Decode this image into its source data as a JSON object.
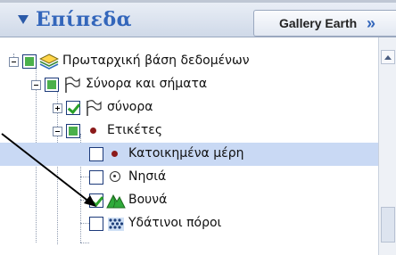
{
  "header": {
    "title": "Επίπεδα",
    "gallery_label": "Gallery Earth",
    "gallery_chevron": "»"
  },
  "tree": {
    "items": [
      {
        "label": "Πρωταρχική βάση δεδομένων",
        "icon": "layers-stack-icon",
        "state": "partial"
      },
      {
        "label": "Σύνορα και σήματα",
        "icon": "flag-icon",
        "state": "partial"
      },
      {
        "label": "σύνορα",
        "icon": "flag-icon",
        "state": "checked"
      },
      {
        "label": "Ετικέτες",
        "icon": "red-dot-icon",
        "state": "partial"
      },
      {
        "label": "Κατοικημένα μέρη",
        "icon": "red-dot-icon",
        "state": "unchecked",
        "selected": true
      },
      {
        "label": "Νησιά",
        "icon": "target-icon",
        "state": "unchecked"
      },
      {
        "label": "Βουνά",
        "icon": "mountain-icon",
        "state": "checked"
      },
      {
        "label": "Υδάτινοι πόροι",
        "icon": "water-pattern-icon",
        "state": "unchecked"
      }
    ]
  },
  "colors": {
    "accent": "#3366bb",
    "selection": "#c9d9f4",
    "check": "#2aa02a"
  }
}
